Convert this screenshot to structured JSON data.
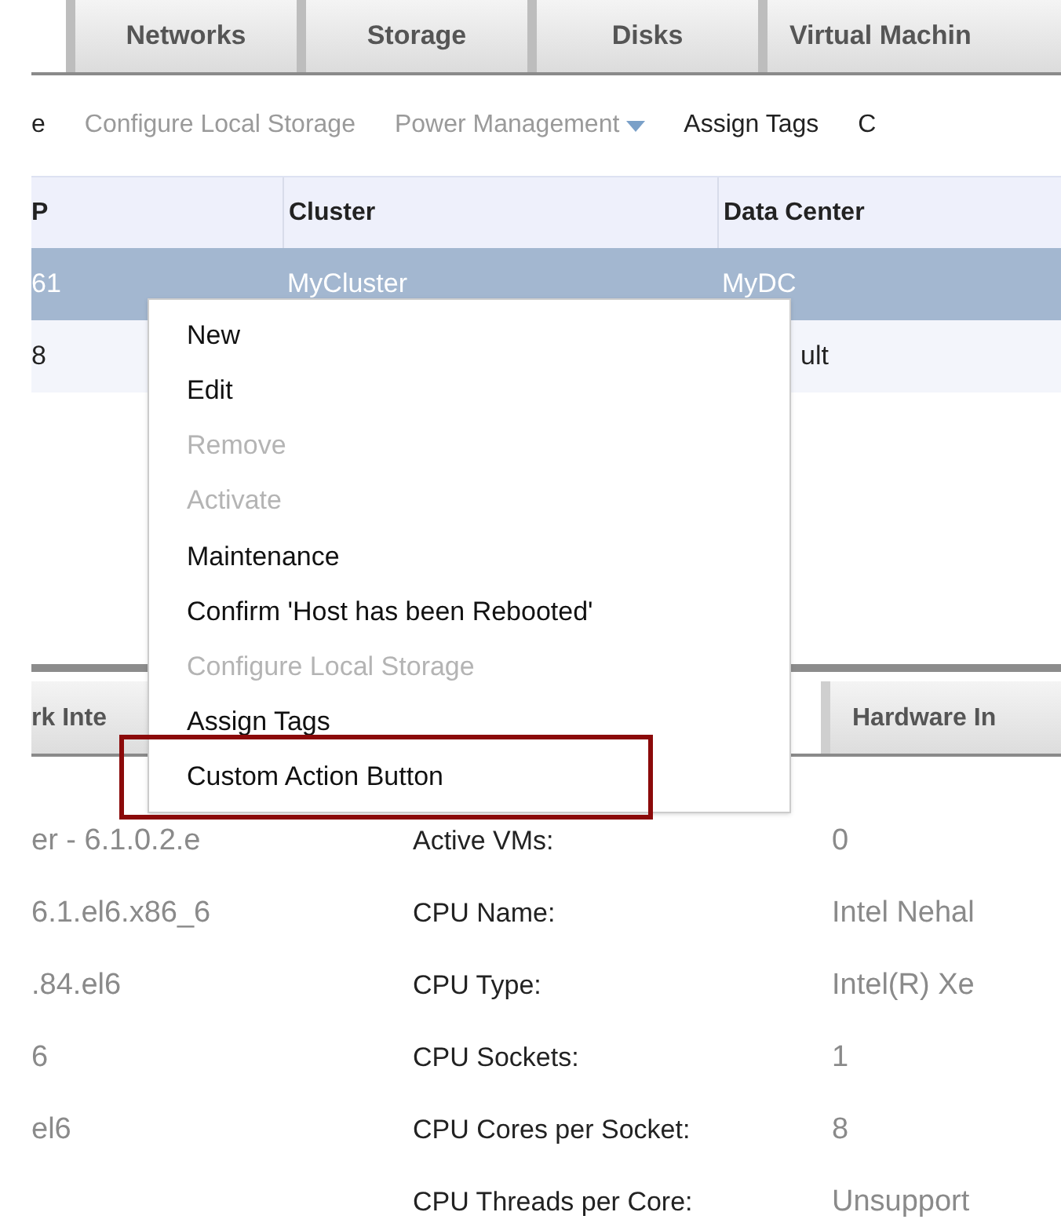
{
  "tabs": [
    {
      "label": "Networks",
      "selected": false
    },
    {
      "label": "Storage",
      "selected": false
    },
    {
      "label": "Disks",
      "selected": false
    },
    {
      "label": "Virtual Machin",
      "selected": false
    }
  ],
  "actions": [
    {
      "label": "e",
      "kind": "button",
      "disabled": false
    },
    {
      "label": "Configure Local Storage",
      "kind": "button",
      "disabled": true
    },
    {
      "label": "Power Management",
      "kind": "dropdown",
      "disabled": true
    },
    {
      "label": "Assign Tags",
      "kind": "button",
      "disabled": false
    },
    {
      "label": "C",
      "kind": "button",
      "disabled": false
    }
  ],
  "table": {
    "columns": [
      "P",
      "Cluster",
      "Data Center"
    ],
    "rows": [
      {
        "cells": [
          "61",
          "MyCluster",
          "MyDC"
        ],
        "selected": true
      },
      {
        "cells": [
          "8",
          "",
          "ult"
        ],
        "selected": false
      }
    ]
  },
  "context_menu": {
    "items": [
      {
        "label": "New",
        "disabled": false
      },
      {
        "label": "Edit",
        "disabled": false
      },
      {
        "label": "Remove",
        "disabled": true
      },
      {
        "label": "Activate",
        "disabled": true
      },
      {
        "label": "Maintenance",
        "disabled": false
      },
      {
        "label": "Confirm 'Host has been Rebooted'",
        "disabled": false
      },
      {
        "label": "Configure Local Storage",
        "disabled": true
      },
      {
        "label": "Assign Tags",
        "disabled": false
      },
      {
        "label": "Custom Action Button",
        "disabled": false
      }
    ]
  },
  "sub_tabs": [
    {
      "label": "rk Inte",
      "selected": false
    },
    {
      "label": "Hardware In",
      "selected": false
    }
  ],
  "details": {
    "left_values": [
      "er - 6.1.0.2.e",
      "6.1.el6.x86_6",
      ".84.el6",
      "6",
      "el6"
    ],
    "fields": [
      {
        "label": "Active VMs:",
        "value": "0"
      },
      {
        "label": "CPU Name:",
        "value": "Intel Nehal"
      },
      {
        "label": "CPU Type:",
        "value": "Intel(R) Xe"
      },
      {
        "label": "CPU Sockets:",
        "value": "1"
      },
      {
        "label": "CPU Cores per Socket:",
        "value": "8"
      },
      {
        "label": "CPU Threads per Core:",
        "value": "Unsupport"
      }
    ]
  }
}
